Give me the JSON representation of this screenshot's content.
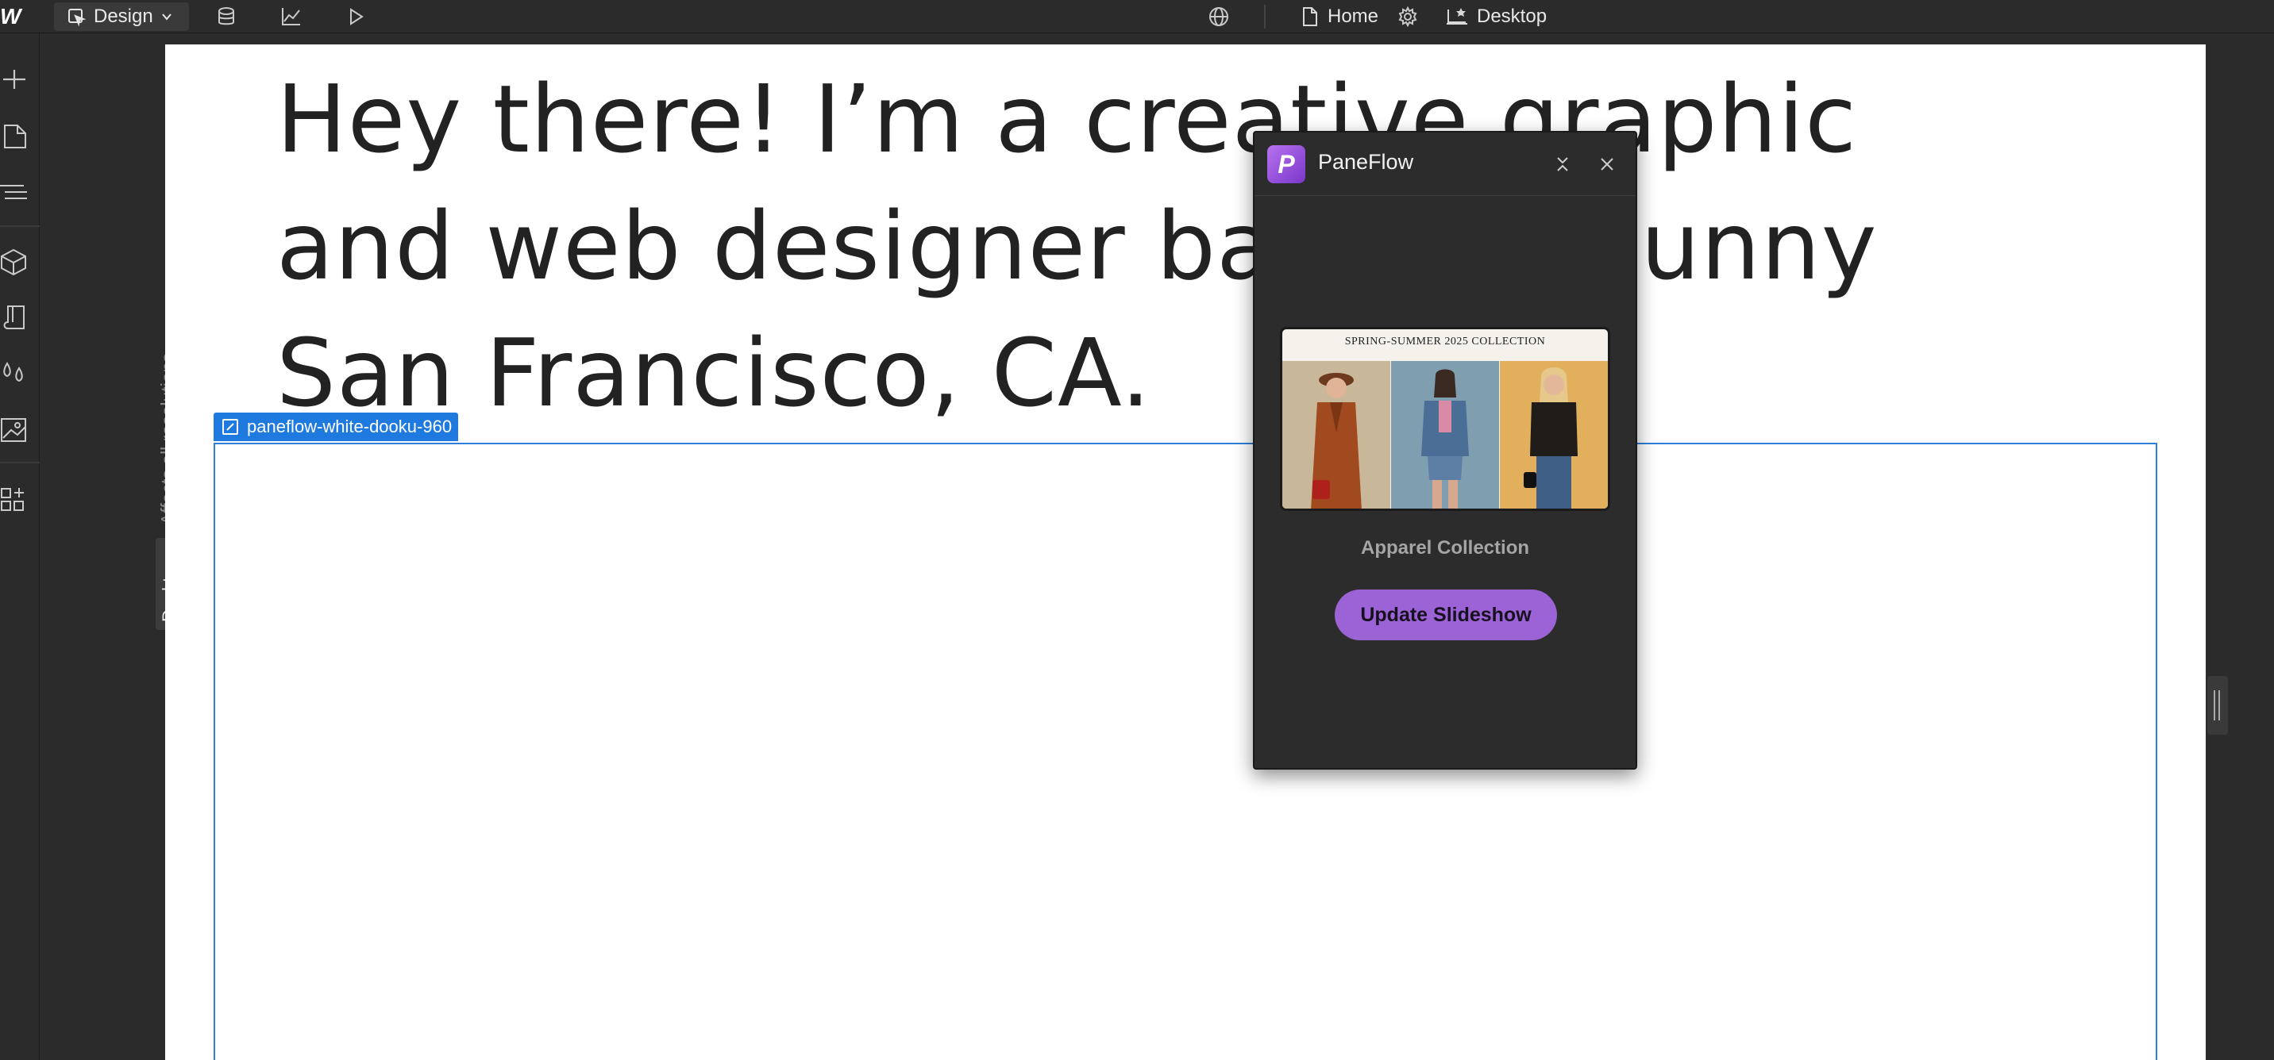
{
  "topbar": {
    "logo": "W",
    "mode_label": "Design",
    "page_label": "Home",
    "breakpoint_label": "Desktop"
  },
  "rail": {
    "scope_text": "Affects all resolutions",
    "breakpoint": "Desktop"
  },
  "canvas": {
    "headline_lines": [
      "Hey there! I’m a creative graphic",
      "and web designer based in sunny",
      "San Francisco, CA."
    ],
    "selected_element": "paneflow-white-dooku-960"
  },
  "panel": {
    "app_logo": "P",
    "title": "PaneFlow",
    "thumbnail_caption": "SPRING-SUMMER 2025 COLLECTION",
    "collection_name": "Apparel Collection",
    "cta_label": "Update Slideshow"
  },
  "colors": {
    "accent": "#9b63d6",
    "selection": "#1f7ae0",
    "toolbar_bg": "#2b2b2b",
    "panel_bg": "#2c2c2c"
  },
  "icons": {
    "topbar": [
      "cursor-icon",
      "chevron-down-icon",
      "database-icon",
      "analytics-icon",
      "play-icon",
      "globe-icon",
      "page-icon",
      "gear-icon",
      "desktop-icon"
    ],
    "leftbar": [
      "add-icon",
      "pages-icon",
      "navigator-icon",
      "components-icon",
      "style-icon",
      "variables-icon",
      "assets-icon",
      "apps-icon"
    ],
    "panel": [
      "collapse-icon",
      "close-icon"
    ]
  }
}
